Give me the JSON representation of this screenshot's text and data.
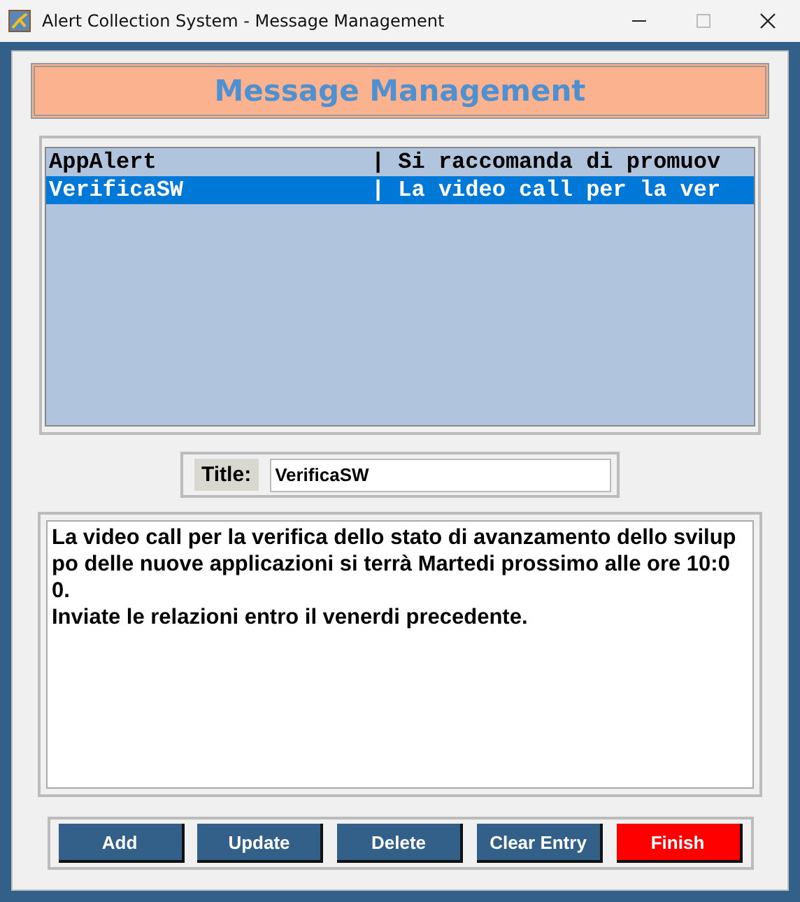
{
  "window": {
    "title": "Alert Collection System - Message Management"
  },
  "header": "Message Management",
  "list": {
    "rows": [
      {
        "text": "AppAlert                | Si raccomanda di promuov",
        "selected": false
      },
      {
        "text": "VerificaSW              | La video call per la ver",
        "selected": true
      }
    ]
  },
  "title_field": {
    "label": "Title:",
    "value": "VerificaSW"
  },
  "message": {
    "lines": [
      "La video call per la verifica dello stato di avanzamento dello svilup",
      "po delle nuove applicazioni si terrà Martedi prossimo alle ore 10:0",
      "0.",
      "Inviate le relazioni entro il venerdi precedente."
    ]
  },
  "buttons": [
    {
      "label": "Add",
      "kind": "normal"
    },
    {
      "label": "Update",
      "kind": "normal"
    },
    {
      "label": "Delete",
      "kind": "normal"
    },
    {
      "label": "Clear Entry",
      "kind": "normal"
    },
    {
      "label": "Finish",
      "kind": "danger"
    }
  ]
}
